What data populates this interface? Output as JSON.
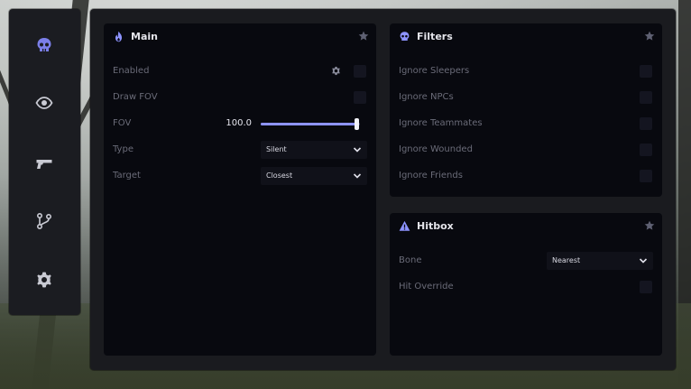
{
  "sidebar": {
    "items": [
      {
        "icon": "skull-icon"
      },
      {
        "icon": "eye-icon"
      },
      {
        "icon": "gun-icon"
      },
      {
        "icon": "branch-icon"
      },
      {
        "icon": "gear-icon"
      }
    ]
  },
  "main": {
    "title": "Main",
    "icon": "flame-icon",
    "enabled_label": "Enabled",
    "draw_fov_label": "Draw FOV",
    "fov_label": "FOV",
    "fov_value": "100.0",
    "fov_fraction": 0.97,
    "type_label": "Type",
    "type_value": "Silent",
    "target_label": "Target",
    "target_value": "Closest"
  },
  "filters": {
    "title": "Filters",
    "icon": "skull-icon",
    "items": [
      "Ignore Sleepers",
      "Ignore NPCs",
      "Ignore Teammates",
      "Ignore Wounded",
      "Ignore Friends"
    ]
  },
  "hitbox": {
    "title": "Hitbox",
    "icon": "warning-icon",
    "bone_label": "Bone",
    "bone_value": "Nearest",
    "hit_override_label": "Hit Override"
  },
  "colors": {
    "accent": "#8d93ff",
    "panel": "#08090f",
    "label": "#6a6b78"
  }
}
